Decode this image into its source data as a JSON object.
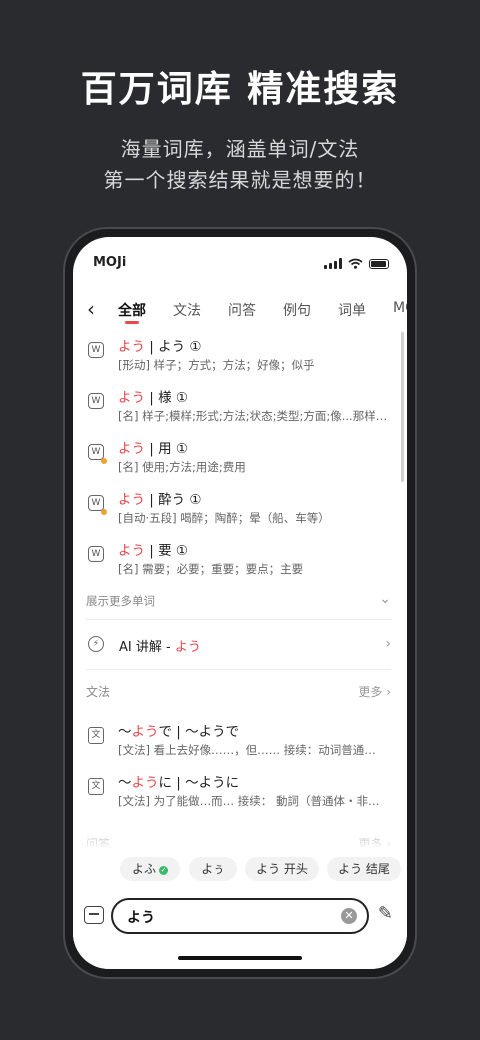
{
  "promo": {
    "headline": "百万词库 精准搜索",
    "subline1": "海量词库，涵盖单词/文法",
    "subline2": "第一个搜索结果就是想要的！"
  },
  "status": {
    "app_logo": "MOJi"
  },
  "tabs": [
    "全部",
    "文法",
    "问答",
    "例句",
    "词单",
    "MO"
  ],
  "active_tab": "全部",
  "words": [
    {
      "kana": "よう",
      "title": " | よう ①",
      "def": "[形动] 样子；方式；方法；好像；似乎",
      "icon": "W",
      "dot": false
    },
    {
      "kana": "よう",
      "title": " | 様 ①",
      "def": "[名] 样子;模样;形式;方法;状态;类型;方面;像...那样…",
      "icon": "W",
      "dot": false
    },
    {
      "kana": "よう",
      "title": " | 用 ①",
      "def": "[名] 使用;方法;用途;费用",
      "icon": "W",
      "dot": true
    },
    {
      "kana": "よう",
      "title": " | 酔う ①",
      "def": "[自动·五段] 喝醉；陶醉；晕（船、车等）",
      "icon": "W",
      "dot": true
    },
    {
      "kana": "よう",
      "title": " | 要 ①",
      "def": "[名] 需要；必要；重要；要点；主要",
      "icon": "W",
      "dot": false
    }
  ],
  "more_words_label": "展示更多单词",
  "ai": {
    "label": "AI 讲解 - ",
    "kana": "よう"
  },
  "grammar": {
    "title": "文法",
    "more": "更多",
    "items": [
      {
        "prefix": "～",
        "kana": "よう",
        "suffix": "で | ～ようで",
        "def": "[文法] 看上去好像……，但…… 接续：动词普通…",
        "icon": "文"
      },
      {
        "prefix": "～",
        "kana": "よう",
        "suffix": "に | ～ように",
        "def": "[文法] 为了能做…而… 接续： 動詞（普通体・非…",
        "icon": "文"
      }
    ]
  },
  "qa": {
    "title": "问答",
    "more": "更多"
  },
  "chips": [
    {
      "label": "よふ",
      "check": true
    },
    {
      "label": "よぅ",
      "check": false
    },
    {
      "label": "よう 开头",
      "check": false
    },
    {
      "label": "よう 结尾",
      "check": false
    }
  ],
  "search": {
    "value": "よう"
  },
  "icons": {
    "scan": "scan-icon",
    "pen": "handwriting-icon",
    "clear": "clear-icon",
    "back": "back-icon"
  },
  "colors": {
    "accent": "#e8484c",
    "check": "#3cb96b",
    "dot": "#f0a030"
  }
}
